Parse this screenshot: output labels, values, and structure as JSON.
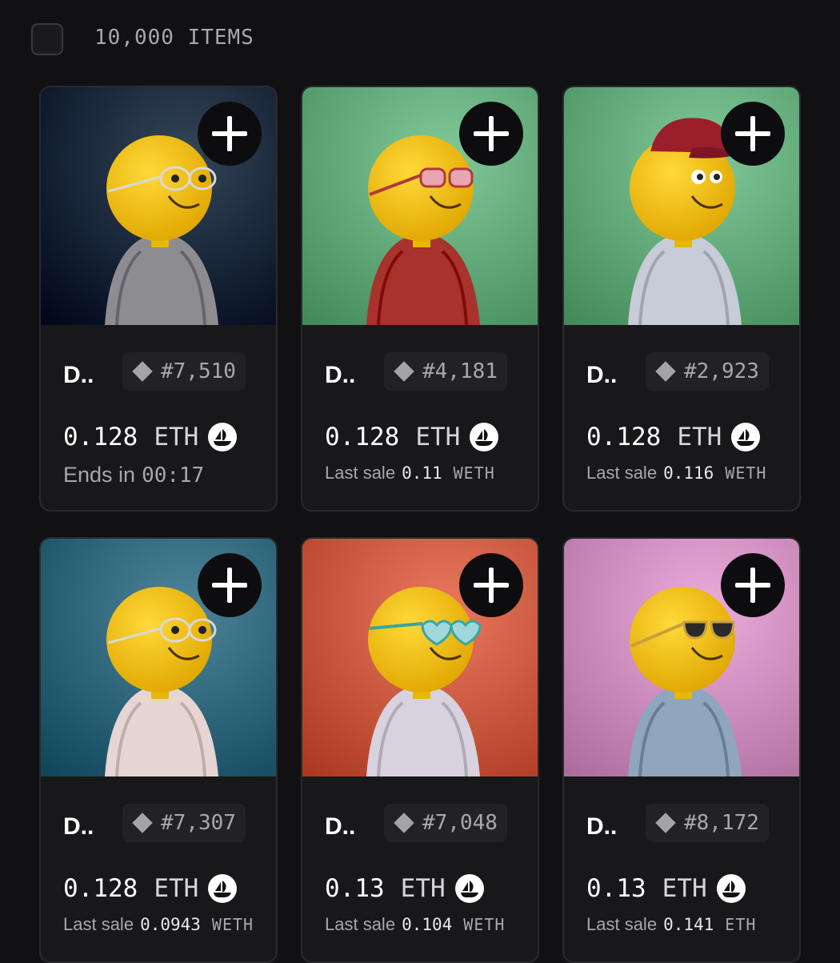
{
  "header": {
    "items_count": "10,000 ITEMS"
  },
  "colors": {
    "page_bg": "#111113",
    "card_bg": "#18181b",
    "bg_navy": "#223447",
    "bg_green": "#6fb786",
    "bg_teal": "#3d7388",
    "bg_orange": "#d8664d",
    "bg_pink": "#d999c9"
  },
  "cards": [
    {
      "name": "D..",
      "token_id": "#7,510",
      "price": "0.128",
      "currency": "ETH",
      "sub_label": "Ends in",
      "sub_value": "00:17",
      "sub_unit": "",
      "image": {
        "bg": "#223447",
        "shirt": "#8d8d91",
        "accessory": "glasses"
      }
    },
    {
      "name": "D..",
      "token_id": "#4,181",
      "price": "0.128",
      "currency": "ETH",
      "sub_label": "Last sale",
      "sub_value": "0.11",
      "sub_unit": "WETH",
      "image": {
        "bg": "#6fb786",
        "shirt": "#a8322c",
        "accessory": "pink-sunglasses"
      }
    },
    {
      "name": "D..",
      "token_id": "#2,923",
      "price": "0.128",
      "currency": "ETH",
      "sub_label": "Last sale",
      "sub_value": "0.116",
      "sub_unit": "WETH",
      "image": {
        "bg": "#6fb786",
        "shirt": "#c7ccd8",
        "accessory": "red-cap"
      }
    },
    {
      "name": "D..",
      "token_id": "#7,307",
      "price": "0.128",
      "currency": "ETH",
      "sub_label": "Last sale",
      "sub_value": "0.0943",
      "sub_unit": "WETH",
      "image": {
        "bg": "#3d7388",
        "shirt": "#e6d5d2",
        "accessory": "glasses"
      }
    },
    {
      "name": "D..",
      "token_id": "#7,048",
      "price": "0.13",
      "currency": "ETH",
      "sub_label": "Last sale",
      "sub_value": "0.104",
      "sub_unit": "WETH",
      "image": {
        "bg": "#d8664d",
        "shirt": "#d7d2dd",
        "accessory": "heart-glasses"
      }
    },
    {
      "name": "D..",
      "token_id": "#8,172",
      "price": "0.13",
      "currency": "ETH",
      "sub_label": "Last sale",
      "sub_value": "0.141",
      "sub_unit": "ETH",
      "image": {
        "bg": "#d999c9",
        "shirt": "#8fa6be",
        "accessory": "dark-sunglasses"
      }
    }
  ]
}
